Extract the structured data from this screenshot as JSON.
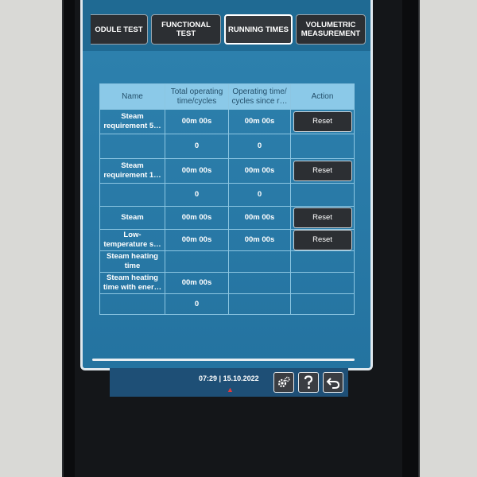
{
  "tabs": [
    {
      "label": "ODULE TEST",
      "active": false
    },
    {
      "label": "FUNCTIONAL TEST",
      "active": false
    },
    {
      "label": "RUNNING TIMES",
      "active": true
    },
    {
      "label": "VOLUMETRIC MEASUREMENT",
      "active": false
    }
  ],
  "table": {
    "headers": [
      "Name",
      "Total operating time/cycles",
      "Operating time/ cycles since r…",
      "Action"
    ],
    "rows": [
      {
        "name": "Steam requirement 5…",
        "total": "00m 00s",
        "since": "00m 00s",
        "action": "Reset"
      },
      {
        "name": "",
        "total": "0",
        "since": "0",
        "action": ""
      },
      {
        "name": "Steam requirement 1…",
        "total": "00m 00s",
        "since": "00m 00s",
        "action": "Reset"
      },
      {
        "name": "",
        "total": "0",
        "since": "0",
        "action": ""
      },
      {
        "name": "Steam",
        "total": "00m 00s",
        "since": "00m 00s",
        "action": "Reset"
      },
      {
        "name": "Low-temperature s…",
        "total": "00m 00s",
        "since": "00m 00s",
        "action": "Reset"
      },
      {
        "name": "Steam heating time",
        "total": "",
        "since": "",
        "action": ""
      },
      {
        "name": "Steam heating time with ener…",
        "total": "00m 00s",
        "since": "",
        "action": ""
      },
      {
        "name": "",
        "total": "0",
        "since": "",
        "action": ""
      }
    ]
  },
  "status": {
    "time": "07:29",
    "separator": "|",
    "date": "15.10.2022"
  },
  "icons": {
    "settings": "gear-icon",
    "help": "question-icon",
    "back": "back-arrow-icon"
  },
  "colors": {
    "screen_bg": "#2a7aa5",
    "header_bg": "#8bc9e8",
    "button_bg": "#2c2f33"
  }
}
